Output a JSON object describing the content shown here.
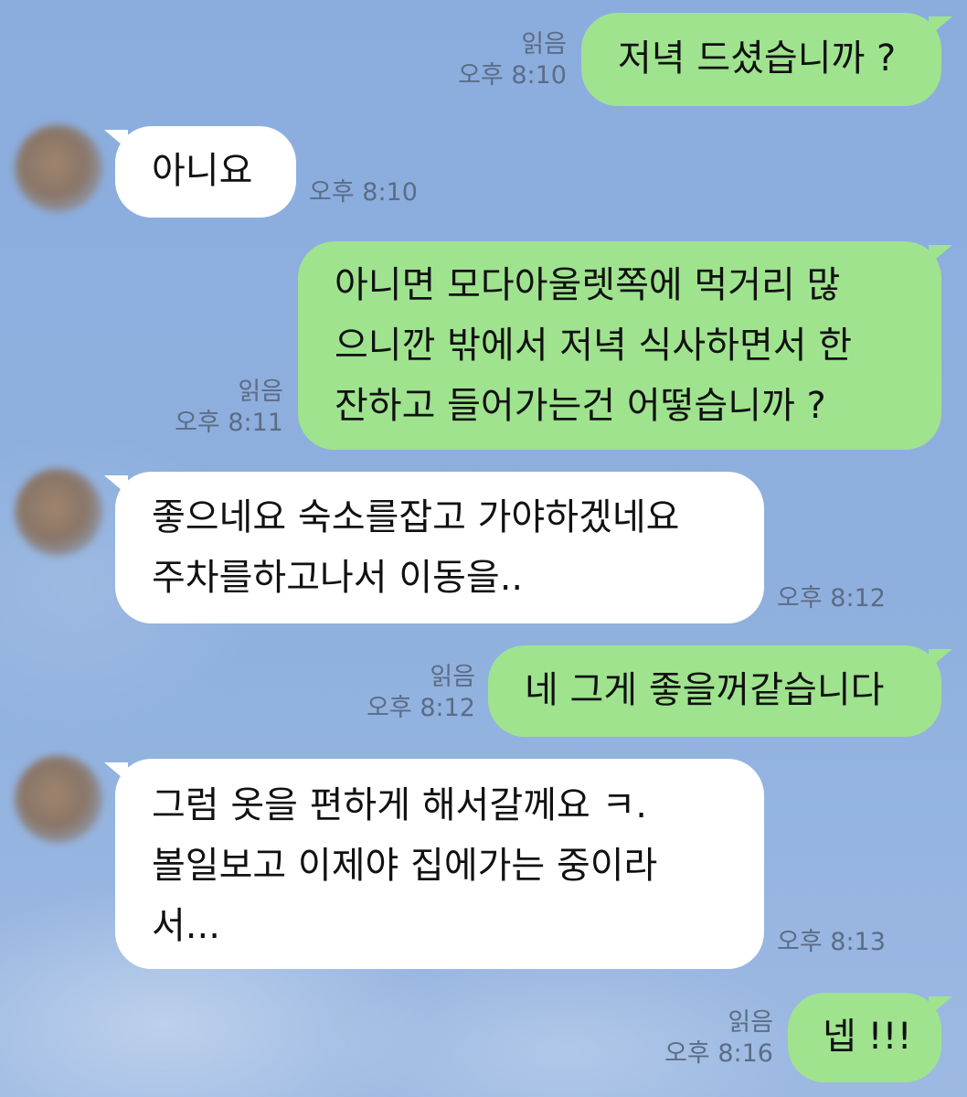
{
  "messages": [
    {
      "from": "me",
      "lines": [
        "저녁 드셨습니까 ?"
      ],
      "read": "읽음",
      "time": "오후 8:10"
    },
    {
      "from": "them",
      "lines": [
        "아니요"
      ],
      "time": "오후 8:10"
    },
    {
      "from": "me",
      "lines": [
        "아니면 모다아울렛쪽에 먹거리 많",
        "으니깐 밖에서 저녁 식사하면서 한",
        "잔하고 들어가는건 어떻습니까 ?"
      ],
      "read": "읽음",
      "time": "오후 8:11"
    },
    {
      "from": "them",
      "lines": [
        "좋으네요 숙소를잡고 가야하겠네요",
        "주차를하고나서 이동을.."
      ],
      "time": "오후 8:12"
    },
    {
      "from": "me",
      "lines": [
        "네 그게 좋을꺼같습니다"
      ],
      "read": "읽음",
      "time": "오후 8:12"
    },
    {
      "from": "them",
      "lines": [
        "그럼 옷을 편하게 해서갈께요 ㅋ.",
        "볼일보고 이제야 집에가는 중이라",
        "서..."
      ],
      "time": "오후 8:13"
    },
    {
      "from": "me",
      "lines": [
        "넵 !!!"
      ],
      "read": "읽음",
      "time": "오후 8:16"
    }
  ],
  "colors": {
    "background": "#8eaedc",
    "outgoing_bubble": "#9fe38f",
    "incoming_bubble": "#ffffff",
    "meta_text": "#5b6c86"
  },
  "icons": {
    "avatar": "blurred-profile-avatar"
  }
}
